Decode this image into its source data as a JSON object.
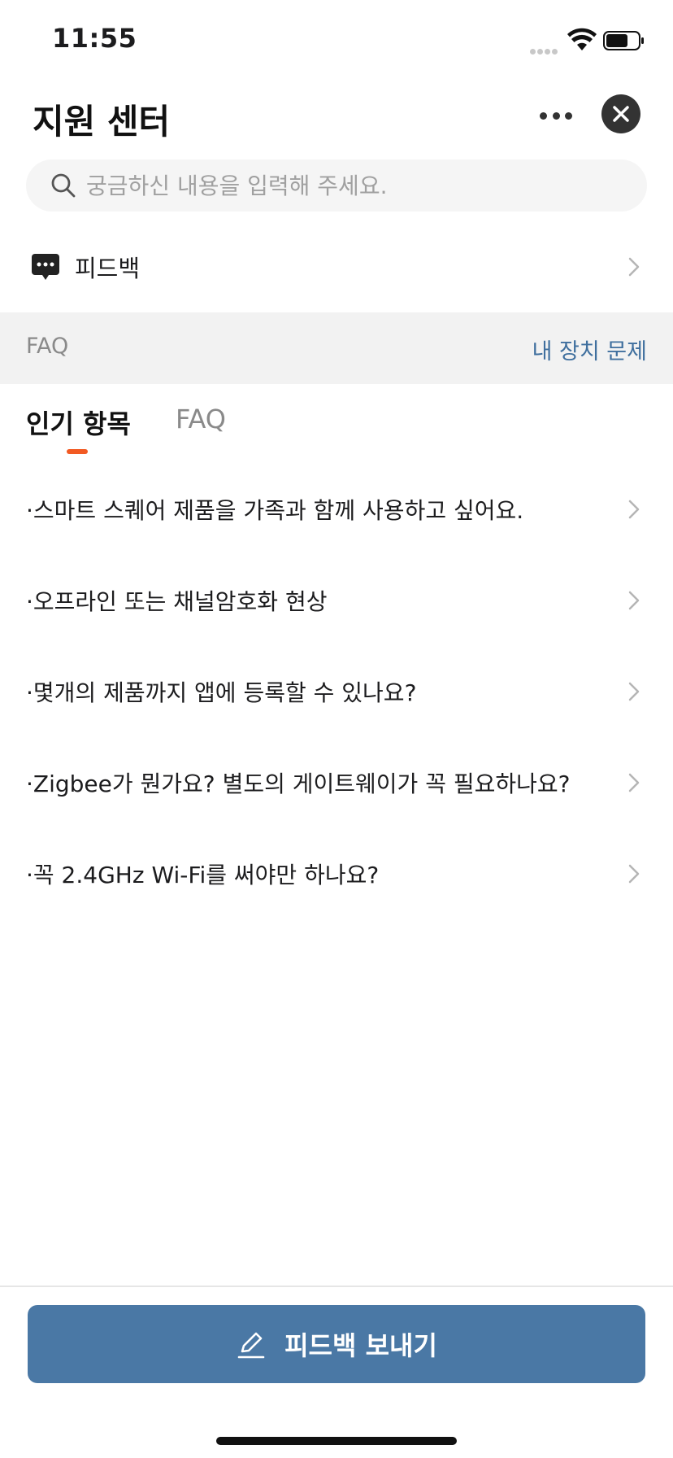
{
  "status_bar": {
    "time": "11:55",
    "icons": [
      "signal-icon",
      "wifi-icon",
      "battery-icon"
    ]
  },
  "header": {
    "title": "지원 센터",
    "icons": [
      "more-icon",
      "close-icon"
    ]
  },
  "search": {
    "placeholder": "궁금하신 내용을 입력해 주세요.",
    "value": "",
    "icon": "search-icon"
  },
  "feedback_row": {
    "label": "피드백",
    "icon": "chat-bubble-icon"
  },
  "faq_section": {
    "title": "FAQ",
    "link_label": "내 장치 문제"
  },
  "tabs": [
    {
      "label": "인기 항목",
      "selected": true
    },
    {
      "label": "FAQ",
      "selected": false
    }
  ],
  "faq_items": [
    {
      "text": "·스마트 스퀘어 제품을 가족과 함께 사용하고 싶어요."
    },
    {
      "text": "·오프라인 또는 채널암호화 현상"
    },
    {
      "text": "·몇개의 제품까지 앱에 등록할 수 있나요?"
    },
    {
      "text": "·Zigbee가 뭔가요? 별도의 게이트웨이가 꼭 필요하나요?"
    },
    {
      "text": "·꼭 2.4GHz Wi-Fi를 써야만 하나요?"
    }
  ],
  "footer": {
    "send_button_label": "피드백 보내기",
    "send_icon": "edit-icon"
  },
  "colors": {
    "accent": "#f25a23",
    "primary_button": "#4a78a5",
    "link": "#3f6f9e"
  }
}
